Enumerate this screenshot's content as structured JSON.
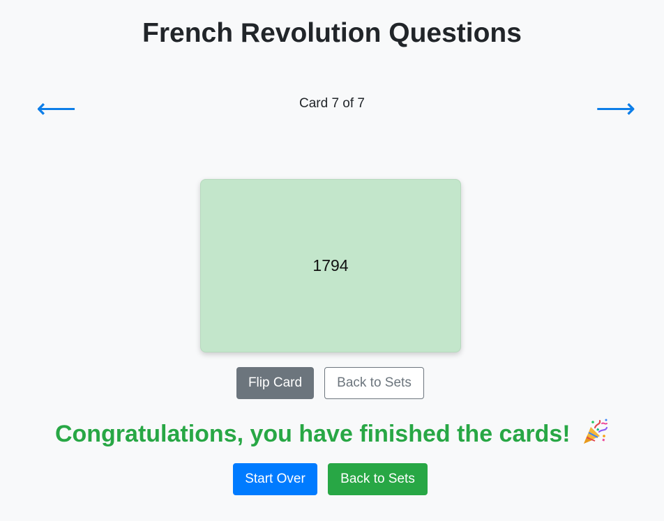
{
  "page": {
    "title": "French Revolution Questions"
  },
  "navigation": {
    "prev_icon": "arrow-left-icon",
    "prev_glyph": "⟵",
    "next_icon": "arrow-right-icon",
    "next_glyph": "⟶",
    "counter_text": "Card 7 of 7",
    "current_card": 7,
    "total_cards": 7
  },
  "card": {
    "side": "answer",
    "content": "1794",
    "background_color": "#c3e6cb"
  },
  "card_actions": {
    "flip_label": "Flip Card",
    "back_label": "Back to Sets"
  },
  "completion": {
    "message": "Congratulations, you have finished the cards!",
    "icon": "party-popper-icon",
    "start_over_label": "Start Over",
    "back_label": "Back to Sets",
    "message_color": "#28a745"
  },
  "colors": {
    "primary": "#007bff",
    "success": "#28a745",
    "secondary": "#6c757d",
    "arrow": "#0d7ee8"
  }
}
